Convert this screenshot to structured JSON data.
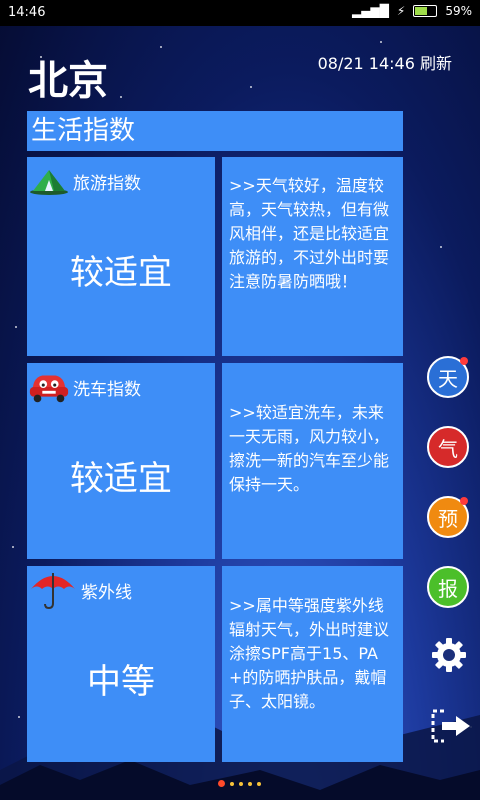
{
  "status_bar": {
    "time": "14:46",
    "battery": "59%"
  },
  "header": {
    "city": "北京",
    "updated": "08/21 14:46 刷新"
  },
  "section": {
    "title": "生活指数"
  },
  "cards": [
    {
      "label": "旅游指数",
      "value": "较适宜",
      "text": ">>天气较好，温度较高，天气较热，但有微风相伴，还是比较适宜旅游的，不过外出时要注意防暑防晒哦！"
    },
    {
      "label": "洗车指数",
      "value": "较适宜",
      "text": ">>较适宜洗车，未来一天无雨，风力较小，擦洗一新的汽车至少能保持一天。"
    },
    {
      "label": "紫外线",
      "value": "中等",
      "text": ">>属中等强度紫外线辐射天气，外出时建议涂擦SPF高于15、PA+的防晒护肤品，戴帽子、太阳镜。"
    }
  ],
  "side_nav": [
    {
      "label": "天",
      "color": "#2a6fd6"
    },
    {
      "label": "气",
      "color": "#d62a2a"
    },
    {
      "label": "预",
      "color": "#f08a10"
    },
    {
      "label": "报",
      "color": "#4bbf2a"
    }
  ],
  "icons": {
    "settings": "gear-icon",
    "exit": "exit-icon"
  },
  "pager": {
    "pages": 5,
    "active": 1
  }
}
